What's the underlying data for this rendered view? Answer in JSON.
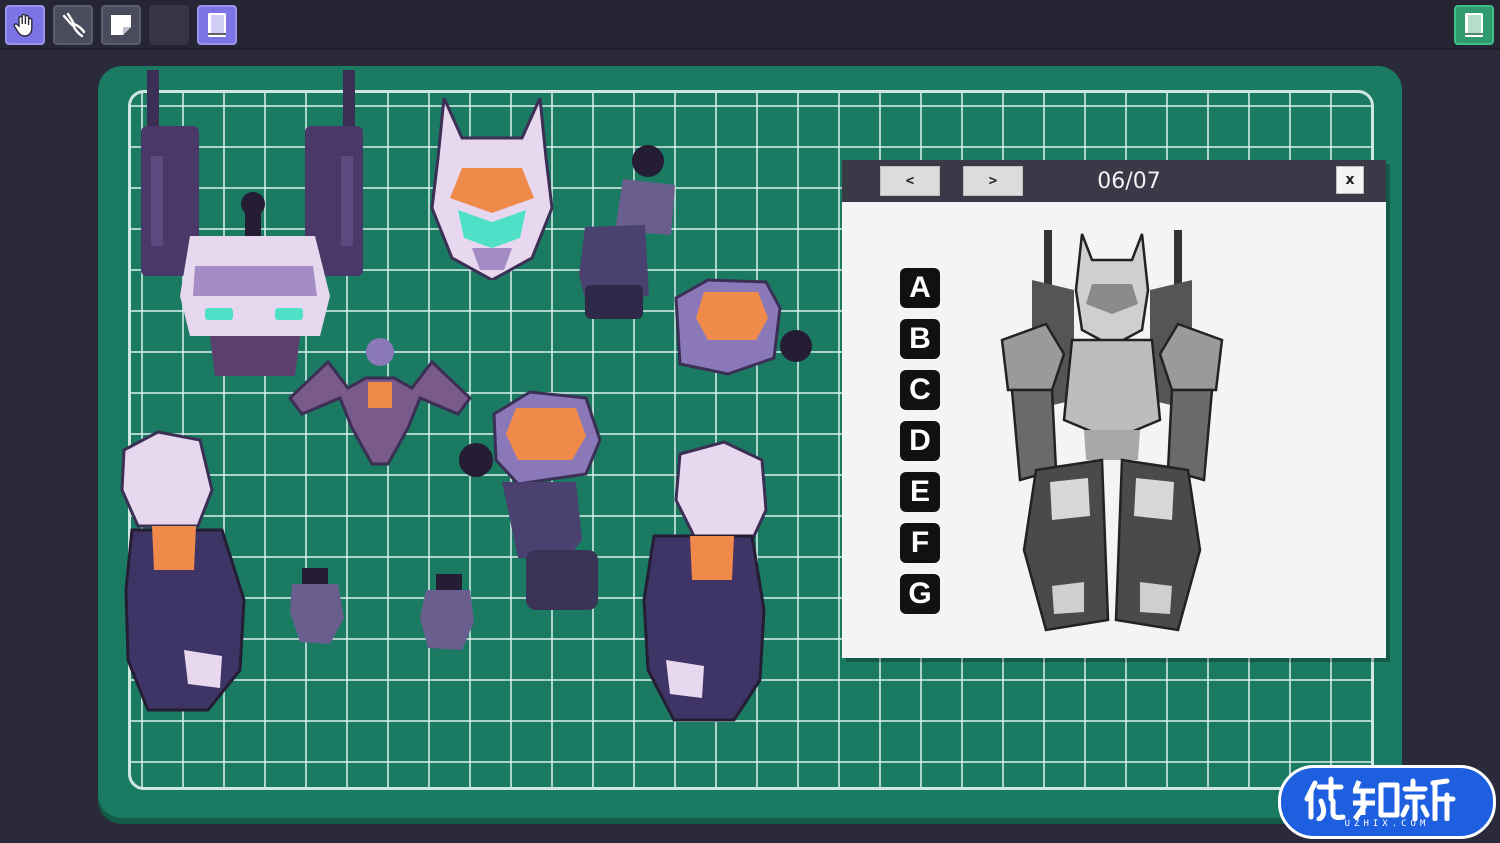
{
  "toolbar": {
    "tools": [
      {
        "name": "hand-tool",
        "icon": "hand-icon",
        "active": true
      },
      {
        "name": "pliers-tool",
        "icon": "pliers-icon",
        "active": false
      },
      {
        "name": "sticker-tool",
        "icon": "sticker-icon",
        "active": false
      },
      {
        "name": "empty-slot",
        "icon": "",
        "active": false
      },
      {
        "name": "manual-tool",
        "icon": "book-icon",
        "active": true
      }
    ],
    "right_tool": {
      "name": "manual-toggle",
      "icon": "book-icon"
    }
  },
  "blueprint": {
    "prev_label": "<",
    "next_label": ">",
    "page_label": "06/07",
    "close_label": "x",
    "letters": [
      "A",
      "B",
      "C",
      "D",
      "E",
      "F",
      "G"
    ]
  },
  "colors": {
    "mat": "#1a7a62",
    "mat_grid": "#cfe7e0",
    "active_tool": "#7b73e6",
    "armor_light": "#e8d8ef",
    "armor_dark": "#3b2f55",
    "accent_orange": "#f08a4b",
    "accent_teal": "#4fe0c8"
  },
  "watermark": {
    "logo_text": "优知新",
    "domain_text": "UZHIX.COM"
  }
}
